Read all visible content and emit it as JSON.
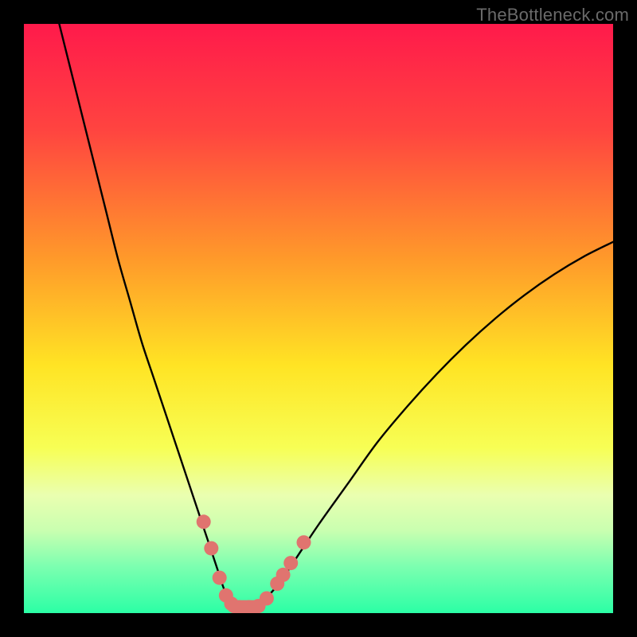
{
  "watermark": "TheBottleneck.com",
  "chart_data": {
    "type": "line",
    "title": "",
    "xlabel": "",
    "ylabel": "",
    "xlim": [
      0,
      100
    ],
    "ylim": [
      0,
      100
    ],
    "gradient_stops": [
      {
        "offset": 0,
        "color": "#ff1a4b"
      },
      {
        "offset": 18,
        "color": "#ff4440"
      },
      {
        "offset": 40,
        "color": "#ff9a2a"
      },
      {
        "offset": 58,
        "color": "#ffe424"
      },
      {
        "offset": 72,
        "color": "#f7ff55"
      },
      {
        "offset": 80,
        "color": "#eaffb0"
      },
      {
        "offset": 86,
        "color": "#c9ffb0"
      },
      {
        "offset": 92,
        "color": "#7dffb0"
      },
      {
        "offset": 100,
        "color": "#2bffa5"
      }
    ],
    "series": [
      {
        "name": "bottleneck-curve",
        "x": [
          6,
          8,
          10,
          12,
          14,
          16,
          18,
          20,
          22,
          24,
          26,
          28,
          30,
          31,
          32,
          33,
          34,
          35,
          36,
          37,
          38,
          39,
          40,
          42,
          44,
          46,
          50,
          55,
          60,
          65,
          70,
          75,
          80,
          85,
          90,
          95,
          100
        ],
        "y": [
          100,
          92,
          84,
          76,
          68,
          60,
          53,
          46,
          40,
          34,
          28,
          22,
          16,
          13,
          10,
          7,
          4,
          2.2,
          1.4,
          1.1,
          1,
          1.1,
          1.6,
          3.5,
          6,
          9,
          15,
          22,
          29,
          35,
          40.5,
          45.5,
          50,
          54,
          57.5,
          60.5,
          63
        ]
      }
    ],
    "markers": {
      "name": "threshold-points",
      "color": "#e0746f",
      "radius": 9,
      "points": [
        {
          "x": 30.5,
          "y": 15.5
        },
        {
          "x": 31.8,
          "y": 11
        },
        {
          "x": 33.2,
          "y": 6
        },
        {
          "x": 34.3,
          "y": 3
        },
        {
          "x": 35.2,
          "y": 1.6
        },
        {
          "x": 36.5,
          "y": 1
        },
        {
          "x": 38.2,
          "y": 1
        },
        {
          "x": 39.8,
          "y": 1.2
        },
        {
          "x": 41.2,
          "y": 2.5
        },
        {
          "x": 43.0,
          "y": 5
        },
        {
          "x": 44.0,
          "y": 6.5
        },
        {
          "x": 45.3,
          "y": 8.5
        },
        {
          "x": 47.5,
          "y": 12
        }
      ]
    },
    "bottom_bar": {
      "color": "#e0746f",
      "x_start": 34.5,
      "x_end": 40.5,
      "height": 2.2
    }
  }
}
